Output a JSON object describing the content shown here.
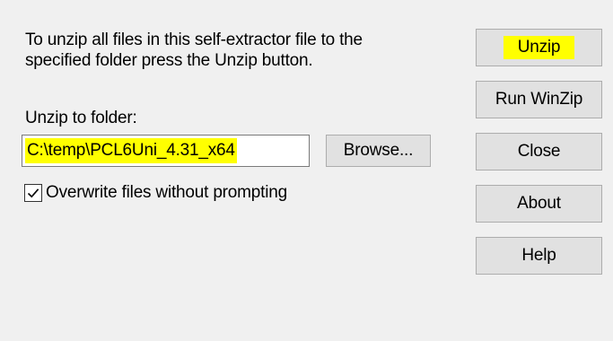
{
  "dialog": {
    "instructions": "To unzip all files in this self-extractor file to the\nspecified folder press the Unzip button.",
    "folder_label": "Unzip to folder:",
    "folder_value": "C:\\temp\\PCL6Uni_4.31_x64",
    "browse_label": "Browse...",
    "overwrite_label": "Overwrite files without prompting",
    "overwrite_checked": true
  },
  "buttons": {
    "unzip": "Unzip",
    "run_winzip": "Run WinZip",
    "close": "Close",
    "about": "About",
    "help": "Help"
  },
  "colors": {
    "dialog_bg": "#f0f0f0",
    "highlight": "#ffff00",
    "button_bg": "#e1e1e1",
    "button_border": "#adadad"
  }
}
